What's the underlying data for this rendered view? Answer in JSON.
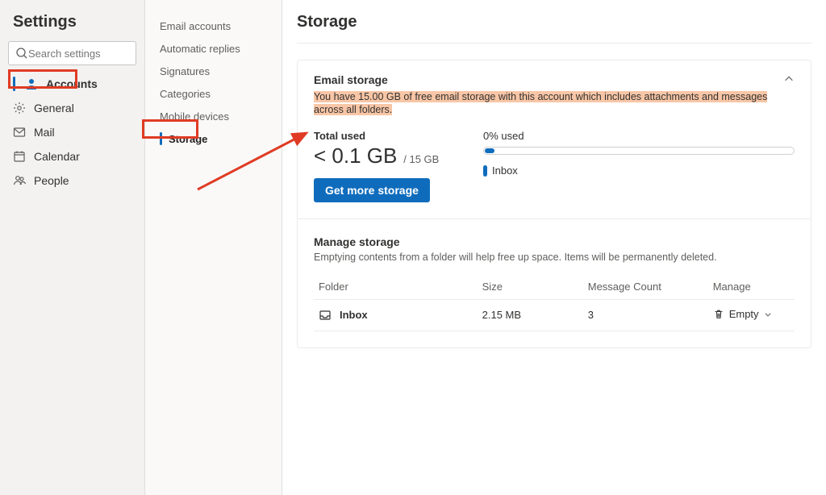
{
  "settings_title": "Settings",
  "search_placeholder": "Search settings",
  "nav": {
    "accounts": "Accounts",
    "general": "General",
    "mail": "Mail",
    "calendar": "Calendar",
    "people": "People"
  },
  "subnav": {
    "email_accounts": "Email accounts",
    "automatic_replies": "Automatic replies",
    "signatures": "Signatures",
    "categories": "Categories",
    "mobile_devices": "Mobile devices",
    "storage": "Storage"
  },
  "page_heading": "Storage",
  "email_storage": {
    "title": "Email storage",
    "desc": "You have 15.00 GB of free email storage with this account which includes attachments and messages across all folders.",
    "total_used_label": "Total used",
    "used_value": "< 0.1 GB",
    "quota": "/ 15 GB",
    "button": "Get more storage",
    "percent_label": "0% used",
    "legend_inbox": "Inbox"
  },
  "manage": {
    "title": "Manage storage",
    "desc": "Emptying contents from a folder will help free up space. Items will be permanently deleted.",
    "col_folder": "Folder",
    "col_size": "Size",
    "col_count": "Message Count",
    "col_manage": "Manage",
    "rows": [
      {
        "folder": "Inbox",
        "size": "2.15 MB",
        "count": "3",
        "action": "Empty"
      }
    ]
  }
}
